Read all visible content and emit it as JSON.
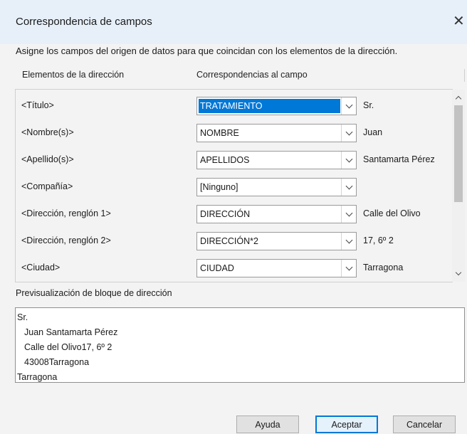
{
  "window": {
    "title": "Correspondencia de campos",
    "close_glyph": "✕"
  },
  "instruction": "Asigne los campos del origen de datos para que coincidan con los elementos de la dirección.",
  "headers": {
    "elements": "Elementos de la dirección",
    "matches": "Correspondencias al campo"
  },
  "rows": [
    {
      "label": "<Título>",
      "field": "TRATAMIENTO",
      "value": "Sr.",
      "selected": true
    },
    {
      "label": "<Nombre(s)>",
      "field": "NOMBRE",
      "value": "Juan"
    },
    {
      "label": "<Apellido(s)>",
      "field": "APELLIDOS",
      "value": "Santamarta Pérez"
    },
    {
      "label": "<Compañía>",
      "field": "[Ninguno]",
      "value": ""
    },
    {
      "label": "<Dirección, renglón 1>",
      "field": "DIRECCIÓN",
      "value": "Calle del Olivo"
    },
    {
      "label": "<Dirección, renglón 2>",
      "field": "DIRECCIÓN*2",
      "value": "17, 6º 2"
    },
    {
      "label": "<Ciudad>",
      "field": "CIUDAD",
      "value": "Tarragona"
    }
  ],
  "preview": {
    "label": "Previsualización de bloque de dirección",
    "lines": [
      "Sr.",
      "Juan Santamarta Pérez",
      "Calle del Olivo17, 6º 2",
      "43008Tarragona",
      "Tarragona"
    ]
  },
  "buttons": {
    "help": "Ayuda",
    "ok": "Aceptar",
    "cancel": "Cancelar"
  },
  "icons": {
    "close": "close-icon",
    "dropdown": "chevron-down-icon",
    "scroll_up": "scroll-up-icon",
    "scroll_down": "scroll-down-icon"
  },
  "colors": {
    "selection": "#0078d7",
    "titlebar": "#e7f0f9",
    "dialog_bg": "#f3f3f3"
  }
}
